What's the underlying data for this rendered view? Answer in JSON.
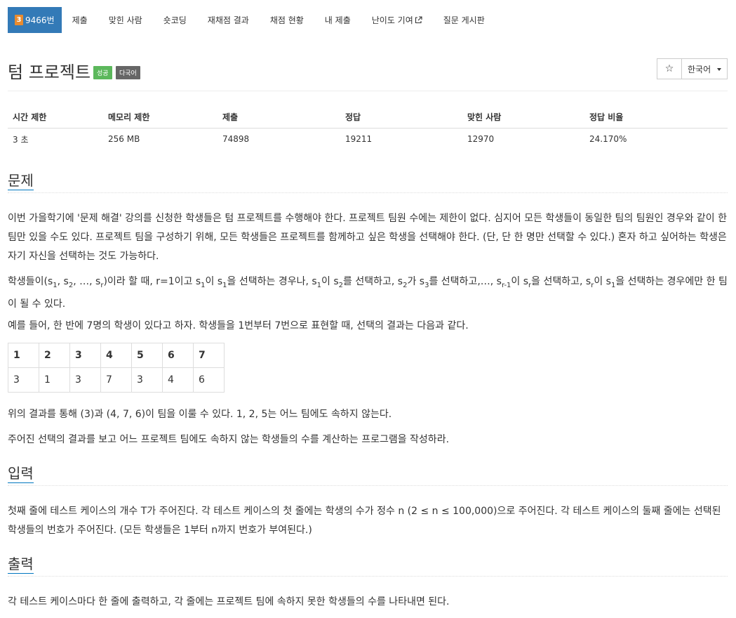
{
  "nav": {
    "problem_tier": "3",
    "problem_number": "9466번",
    "items": [
      "제출",
      "맞힌 사람",
      "숏코딩",
      "재채점 결과",
      "채점 현황",
      "내 제출",
      "난이도 기여",
      "질문 게시판"
    ]
  },
  "title": {
    "text": "텀 프로젝트",
    "label_success": "성공",
    "label_lang": "다국어",
    "star": "☆",
    "language": "한국어"
  },
  "info": {
    "headers": [
      "시간 제한",
      "메모리 제한",
      "제출",
      "정답",
      "맞힌 사람",
      "정답 비율"
    ],
    "values": [
      "3 초",
      "256 MB",
      "74898",
      "19211",
      "12970",
      "24.170%"
    ]
  },
  "sections": {
    "problem": "문제",
    "input": "입력",
    "output": "출력"
  },
  "problem": {
    "p1": "이번 가을학기에 '문제 해결' 강의를 신청한 학생들은 텀 프로젝트를 수행해야 한다. 프로젝트 팀원 수에는 제한이 없다. 심지어 모든 학생들이 동일한 팀의 팀원인 경우와 같이 한 팀만 있을 수도 있다. 프로젝트 팀을 구성하기 위해, 모든 학생들은 프로젝트를 함께하고 싶은 학생을 선택해야 한다. (단, 단 한 명만 선택할 수 있다.) 혼자 하고 싶어하는 학생은 자기 자신을 선택하는 것도 가능하다.",
    "p2_a": "학생들이(s",
    "p2_b": ", s",
    "p2_c": ", …, s",
    "p2_d": ")이라 할 때, r=1이고 s",
    "p2_e": "이 s",
    "p2_f": "을 선택하는 경우나, s",
    "p2_g": "이 s",
    "p2_h": "를 선택하고, s",
    "p2_i": "가 s",
    "p2_j": "를 선택하고,…, s",
    "p2_k": "이 s",
    "p2_l": "을 선택하고, s",
    "p2_m": "이 s",
    "p2_n": "을 선택하는 경우에만 한 팀이 될 수 있다.",
    "sub_1": "1",
    "sub_2": "2",
    "sub_3": "3",
    "sub_r": "r",
    "sub_r1": "r-1",
    "p3": "예를 들어, 한 반에 7명의 학생이 있다고 하자. 학생들을 1번부터 7번으로 표현할 때, 선택의 결과는 다음과 같다.",
    "table_header": [
      "1",
      "2",
      "3",
      "4",
      "5",
      "6",
      "7"
    ],
    "table_row": [
      "3",
      "1",
      "3",
      "7",
      "3",
      "4",
      "6"
    ],
    "p4": "위의 결과를 통해 (3)과 (4, 7, 6)이 팀을 이룰 수 있다. 1, 2, 5는 어느 팀에도 속하지 않는다.",
    "p5": "주어진 선택의 결과를 보고 어느 프로젝트 팀에도 속하지 않는 학생들의 수를 계산하는 프로그램을 작성하라."
  },
  "input": {
    "p1": "첫째 줄에 테스트 케이스의 개수 T가 주어진다. 각 테스트 케이스의 첫 줄에는 학생의 수가 정수 n (2 ≤ n ≤ 100,000)으로 주어진다. 각 테스트 케이스의 둘째 줄에는 선택된 학생들의 번호가 주어진다. (모든 학생들은 1부터 n까지 번호가 부여된다.)"
  },
  "output": {
    "p1": "각 테스트 케이스마다 한 줄에 출력하고, 각 줄에는 프로젝트 팀에 속하지 못한 학생들의 수를 나타내면 된다."
  },
  "colors": {
    "nav_active": "#337ab7",
    "tier_badge": "#e88b2f",
    "label_success": "#5cb85c",
    "label_lang": "#666666",
    "section_underline": "#0076c0"
  }
}
